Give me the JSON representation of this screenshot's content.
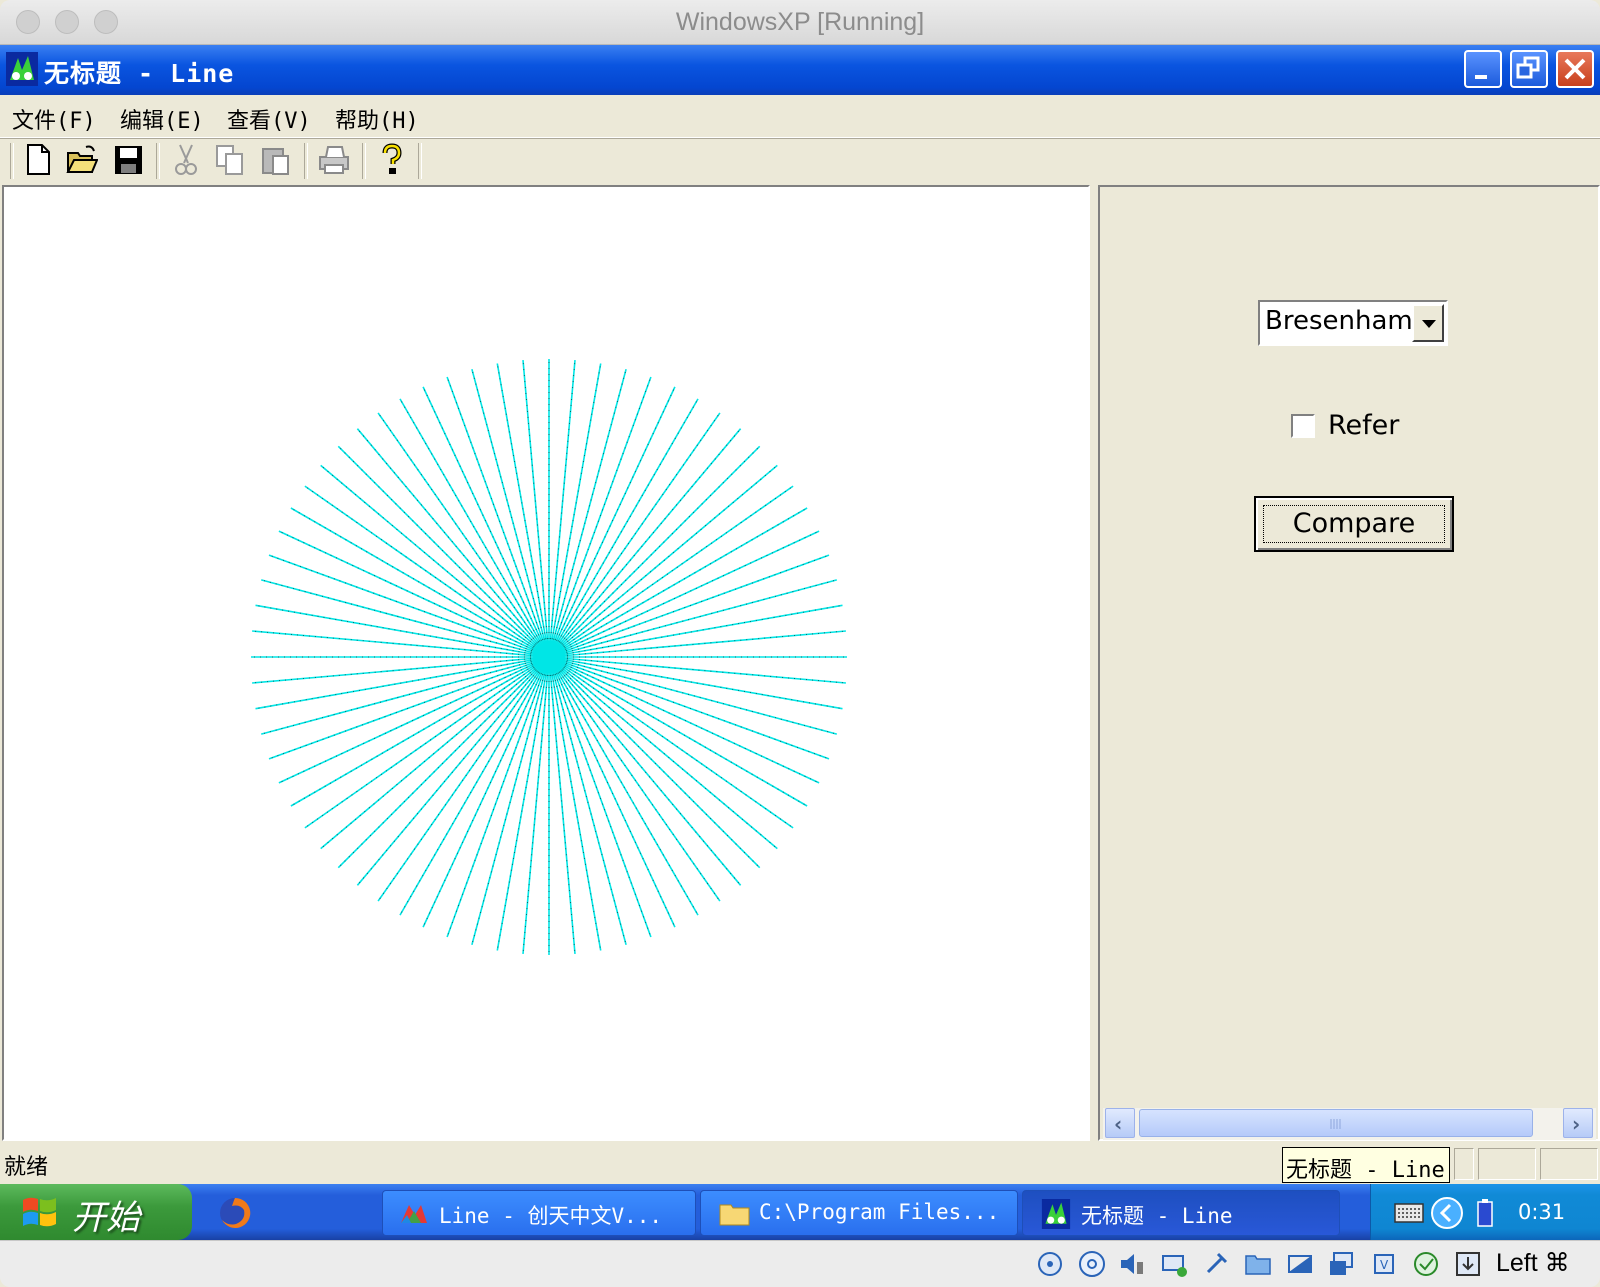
{
  "host_window": {
    "title": "WindowsXP [Running]"
  },
  "app": {
    "title": "无标题 - Line"
  },
  "menu": [
    {
      "label": "文件(F)"
    },
    {
      "label": "编辑(E)"
    },
    {
      "label": "查看(V)"
    },
    {
      "label": "帮助(H)"
    }
  ],
  "toolbar_icons": [
    "new-file-icon",
    "open-folder-icon",
    "save-icon",
    "cut-icon",
    "copy-icon",
    "paste-icon",
    "print-icon",
    "help-icon"
  ],
  "canvas": {
    "ray_color": "#00e6e6",
    "ray_count": 72
  },
  "panel": {
    "algorithm_select": "Bresenham",
    "refer_label": "Refer",
    "refer_checked": false,
    "compare_label": "Compare"
  },
  "status": {
    "text": "就绪"
  },
  "tooltip": {
    "text": "无标题 - Line"
  },
  "taskbar": {
    "start_label": "开始",
    "tasks": [
      {
        "label": "Line - 创天中文V..."
      },
      {
        "label": "C:\\Program Files..."
      },
      {
        "label": "无标题 - Line"
      }
    ],
    "clock": "0:31"
  },
  "vbox": {
    "host_key": "Left ⌘"
  },
  "colors": {
    "xp_title_blue": "#0a55e0",
    "start_green": "#3c9a3c",
    "ray": "#00e6e6"
  }
}
